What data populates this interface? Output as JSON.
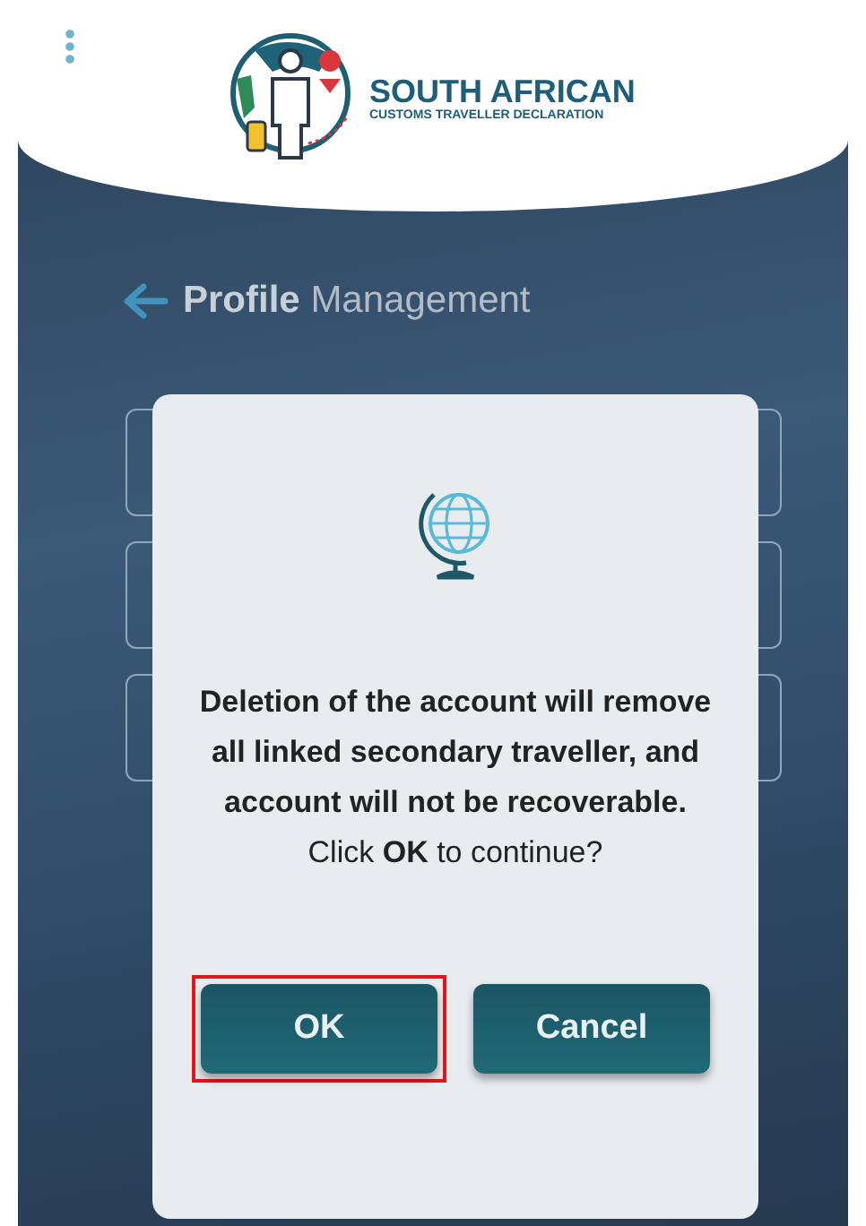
{
  "header": {
    "logo_title": "SOUTH AFRICAN",
    "logo_subtitle": "CUSTOMS TRAVELLER DECLARATION"
  },
  "page_title": {
    "bold": "Profile",
    "rest": "Management"
  },
  "dialog": {
    "message": "Deletion of the account will remove all linked secondary traveller, and account will not be recoverable.",
    "prompt": "Click **OK** to continue?",
    "buttons": [
      {
        "label": "OK",
        "highlighted": true
      },
      {
        "label": "Cancel",
        "highlighted": false
      }
    ]
  }
}
